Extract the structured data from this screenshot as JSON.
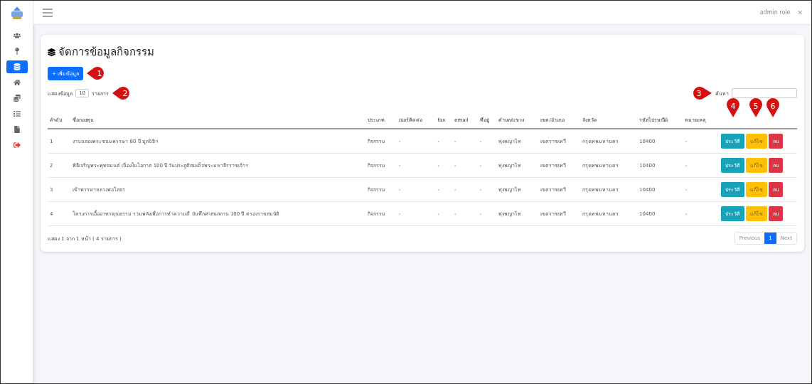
{
  "topbar": {
    "user": "admin role",
    "close": "✕"
  },
  "sidebar": {
    "items": [
      {
        "kind": "users",
        "selected": false
      },
      {
        "kind": "pin",
        "selected": false
      },
      {
        "kind": "stack",
        "selected": true
      },
      {
        "kind": "home",
        "selected": false
      },
      {
        "kind": "coin",
        "selected": false
      },
      {
        "kind": "list",
        "selected": false
      },
      {
        "kind": "file",
        "selected": false
      },
      {
        "kind": "logout",
        "selected": false
      }
    ]
  },
  "page": {
    "title": "จัดการข้อมูลกิจกรรม",
    "add_button": "+ เพิ่มข้อมูล",
    "show_label": "แสดงข้อมูล",
    "page_size": "10",
    "show_suffix": "รายการ",
    "search_label": "ค้นหา"
  },
  "callouts": {
    "add": "1",
    "page_size": "2",
    "search": "3",
    "actions": [
      "4",
      "5",
      "6"
    ]
  },
  "table": {
    "columns": [
      "ลำดับ",
      "ชื่อกองทุน",
      "ประเภท",
      "เบอร์ติดต่อ",
      "fax",
      "email",
      "ที่อยู่",
      "ตำบล/แขวง",
      "เขต/อำเภอ",
      "จังหวัด",
      "รหัสไปรษณีย์",
      "หมายเหตุ"
    ],
    "rows": [
      {
        "cells": [
          "1",
          "งานฉลองพระชนมพรรษา 80 ปี มูลนิธิฯ",
          "กิจกรรม",
          "-",
          "-",
          "-",
          "-",
          "ทุ่งพญาไท",
          "เขตราชเทวี",
          "กรุงเทพมหานคร",
          "10400",
          "-"
        ],
        "actions": [
          "ประวัติ",
          "แก้ไข",
          "ลบ"
        ]
      },
      {
        "cells": [
          "2",
          "พิธีเจริญพระพุทธมนต์ เนื่องในโอกาส 100 ปี วันประสูติสมเด็จพระมหาธีรราชเจ้าฯ",
          "กิจกรรม",
          "-",
          "-",
          "-",
          "-",
          "ทุ่งพญาไท",
          "เขตราชเทวี",
          "กรุงเทพมหานคร",
          "10400",
          "-"
        ],
        "actions": [
          "ประวัติ",
          "แก้ไข",
          "ลบ"
        ]
      },
      {
        "cells": [
          "3",
          "เข้าพรรษาหลวงพ่อโสธร",
          "กิจกรรม",
          "-",
          "-",
          "-",
          "-",
          "ทุ่งพญาไท",
          "เขตราชเทวี",
          "กรุงเทพมหานคร",
          "10400",
          "-"
        ],
        "actions": [
          "ประวัติ",
          "แก้ไข",
          "ลบ"
        ]
      },
      {
        "cells": [
          "4",
          "โครงการเอื้ออาทรคุณธรรม รวมพลังเพื่อการทำความดี บันทึกศาสนสถาน 100 ปี ครองราชสมบัติ",
          "กิจกรรม",
          "-",
          "-",
          "-",
          "-",
          "ทุ่งพญาไท",
          "เขตราชเทวี",
          "กรุงเทพมหานคร",
          "10400",
          "-"
        ],
        "actions": [
          "ประวัติ",
          "แก้ไข",
          "ลบ"
        ]
      }
    ]
  },
  "footer": {
    "info": "แสดง 1 จาก 1 หน้า ( 4 รายการ )",
    "pagination": [
      {
        "label": "Previous",
        "selected": false
      },
      {
        "label": "1",
        "selected": true
      },
      {
        "label": "Next",
        "selected": false
      }
    ]
  }
}
